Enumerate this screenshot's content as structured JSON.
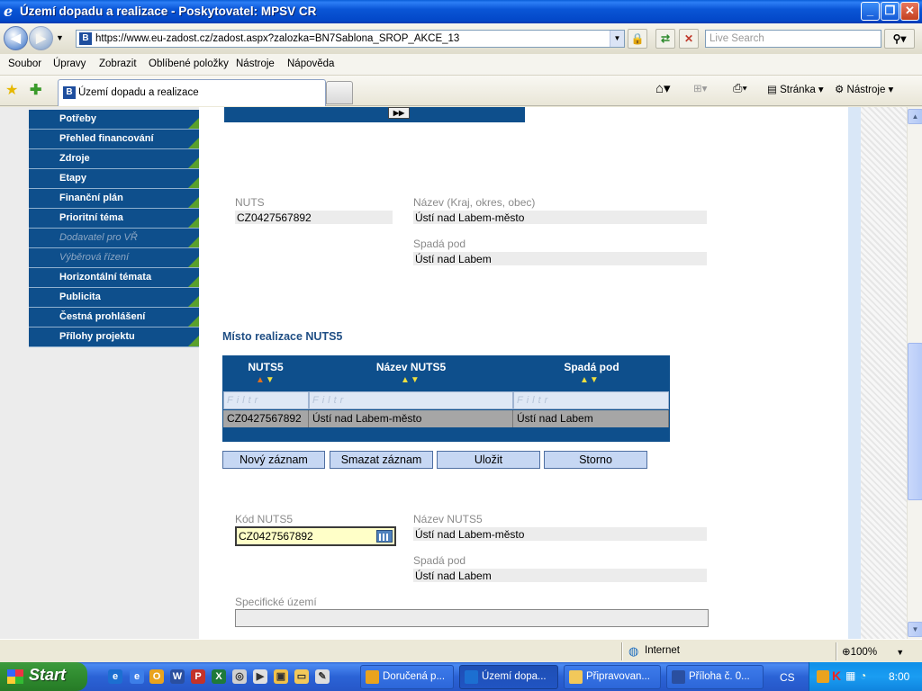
{
  "window": {
    "title": "Území dopadu a realizace - Poskytovatel: MPSV CR"
  },
  "address": {
    "url": "https://www.eu-zadost.cz/zadost.aspx?zalozka=BN7Sablona_SROP_AKCE_13",
    "search_placeholder": "Live Search"
  },
  "menu": [
    "Soubor",
    "Úpravy",
    "Zobrazit",
    "Oblíbené položky",
    "Nástroje",
    "Nápověda"
  ],
  "tab": {
    "title": "Území dopadu a realizace"
  },
  "toolbar": {
    "page_label": "Stránka",
    "tools_label": "Nástroje"
  },
  "sidebar": {
    "items": [
      {
        "label": "Potřeby",
        "disabled": false
      },
      {
        "label": "Přehled financování",
        "disabled": false
      },
      {
        "label": "Zdroje",
        "disabled": false
      },
      {
        "label": "Etapy",
        "disabled": false
      },
      {
        "label": "Finanční plán",
        "disabled": false
      },
      {
        "label": "Prioritní téma",
        "disabled": false
      },
      {
        "label": "Dodavatel pro VŘ",
        "disabled": true
      },
      {
        "label": "Výběrová řízení",
        "disabled": true
      },
      {
        "label": "Horizontální témata",
        "disabled": false
      },
      {
        "label": "Publicita",
        "disabled": false
      },
      {
        "label": "Čestná prohlášení",
        "disabled": false
      },
      {
        "label": "Přílohy projektu",
        "disabled": false
      }
    ]
  },
  "nuts_section": {
    "nuts_label": "NUTS",
    "nuts_value": "CZ0427567892",
    "name_label": "Název (Kraj, okres, obec)",
    "name_value": "Ústí nad Labem-město",
    "parent_label": "Spadá pod",
    "parent_value": "Ústí nad Labem"
  },
  "realization": {
    "title": "Místo realizace NUTS5",
    "columns": [
      "NUTS5",
      "Název NUTS5",
      "Spadá pod"
    ],
    "filter_placeholder": "Filtr",
    "rows": [
      [
        "CZ0427567892",
        "Ústí nad Labem-město",
        "Ústí nad Labem"
      ]
    ],
    "buttons": {
      "new": "Nový záznam",
      "delete": "Smazat záznam",
      "save": "Uložit",
      "cancel": "Storno"
    }
  },
  "detail": {
    "code_label": "Kód NUTS5",
    "code_value": "CZ0427567892",
    "name_label": "Název NUTS5",
    "name_value": "Ústí nad Labem-město",
    "parent_label": "Spadá pod",
    "parent_value": "Ústí nad Labem",
    "specific_label": "Specifické území",
    "specific_value": ""
  },
  "statusbar": {
    "zone": "Internet",
    "zoom": "100%"
  },
  "taskbar": {
    "start": "Start",
    "tasks": [
      "Doručená p...",
      "Území dopa...",
      "Připravovan...",
      "Příloha č. 0..."
    ],
    "lang": "CS",
    "clock": "8:00"
  },
  "colors": {
    "nav_bg": "#0e4f8c",
    "button_bg": "#c6d7f3",
    "input_highlight": "#ffffc8"
  }
}
